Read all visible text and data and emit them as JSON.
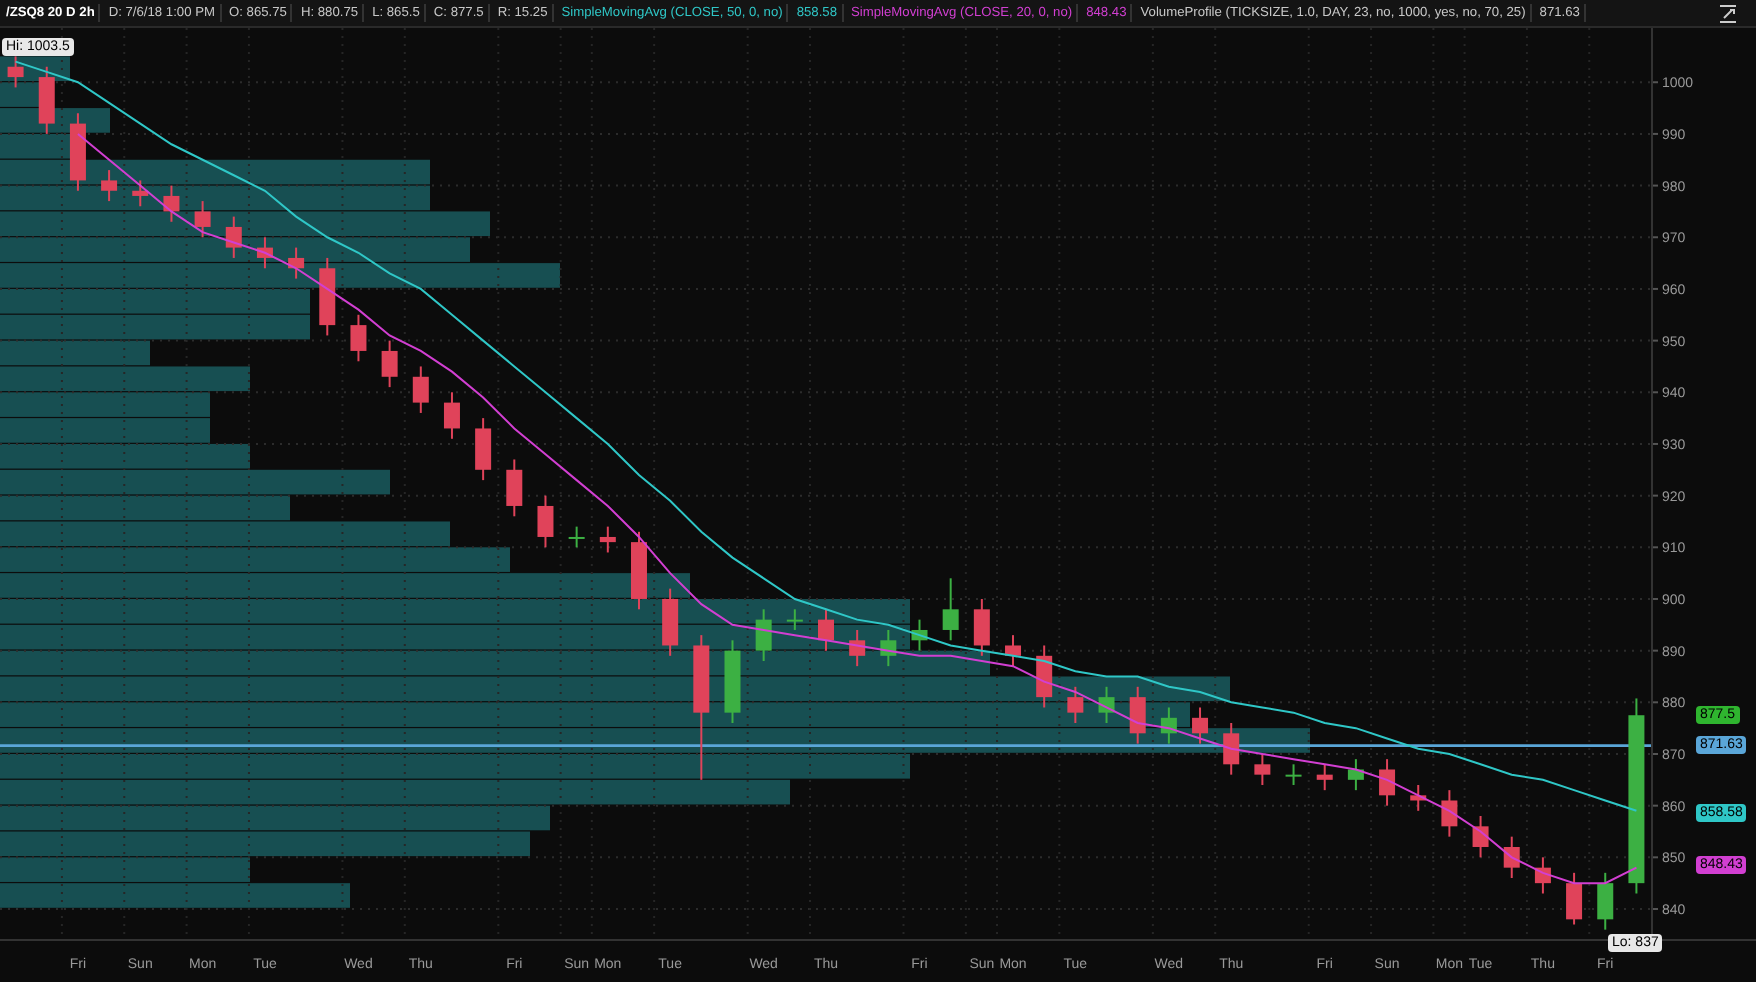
{
  "header": {
    "symbol": "/ZSQ8 20 D 2h",
    "fields": [
      "D: 7/6/18 1:00 PM",
      "O: 865.75",
      "H: 880.75",
      "L: 865.5",
      "C: 877.5",
      "R: 15.25"
    ],
    "series_values": [
      "858.58",
      "848.43"
    ],
    "volume_profile": {
      "label": "VolumeProfile (TICKSIZE, 1.0, DAY, 23, no, 1000, yes, no, 70, 25)",
      "value": "871.63"
    }
  },
  "chart": {
    "hi_label": "Hi: 1003.5",
    "lo_label": "Lo: 837",
    "price_tags": [
      {
        "value": "877.5",
        "color": "#2fb52f"
      },
      {
        "value": "871.63",
        "color": "#5aa6d8"
      },
      {
        "value": "858.58",
        "color": "#2fc7c7"
      },
      {
        "value": "848.43",
        "color": "#d23fd2"
      }
    ],
    "chart_data": {
      "type": "candlestick",
      "ylim": [
        834,
        1010.5
      ],
      "grid": true,
      "yticks": [
        840,
        850,
        860,
        870,
        880,
        890,
        900,
        910,
        920,
        930,
        940,
        950,
        960,
        970,
        980,
        990,
        1000
      ],
      "categories": [
        null,
        null,
        "Fri",
        null,
        "Sun",
        null,
        "Mon",
        null,
        "Tue",
        null,
        null,
        "Wed",
        null,
        "Thu",
        null,
        null,
        "Fri",
        null,
        "Sun",
        "Mon",
        null,
        "Tue",
        null,
        null,
        "Wed",
        null,
        "Thu",
        null,
        null,
        "Fri",
        null,
        "Sun",
        "Mon",
        null,
        "Tue",
        null,
        null,
        "Wed",
        null,
        "Thu",
        null,
        null,
        "Fri",
        null,
        "Sun",
        null,
        "Mon",
        "Tue",
        null,
        "Thu",
        null,
        "Fri",
        null
      ],
      "ohlc": [
        [
          1003,
          1005,
          999,
          1001
        ],
        [
          1001,
          1003,
          990,
          992
        ],
        [
          992,
          994,
          979,
          981
        ],
        [
          981,
          983,
          977,
          979
        ],
        [
          979,
          981,
          976,
          978
        ],
        [
          978,
          980,
          973,
          975
        ],
        [
          975,
          977,
          970,
          972
        ],
        [
          972,
          974,
          966,
          968
        ],
        [
          968,
          970,
          964,
          966
        ],
        [
          966,
          968,
          962,
          964
        ],
        [
          964,
          966,
          951,
          953
        ],
        [
          953,
          955,
          946,
          948
        ],
        [
          948,
          950,
          941,
          943
        ],
        [
          943,
          945,
          936,
          938
        ],
        [
          938,
          940,
          931,
          933
        ],
        [
          933,
          935,
          923,
          925
        ],
        [
          925,
          927,
          916,
          918
        ],
        [
          918,
          920,
          910,
          912
        ],
        [
          912,
          914,
          910,
          912
        ],
        [
          912,
          914,
          909,
          911
        ],
        [
          911,
          913,
          898,
          900
        ],
        [
          900,
          902,
          889,
          891
        ],
        [
          891,
          893,
          865,
          878
        ],
        [
          878,
          892,
          876,
          890
        ],
        [
          890,
          898,
          888,
          896
        ],
        [
          896,
          898,
          894,
          896
        ],
        [
          896,
          898,
          890,
          892
        ],
        [
          892,
          894,
          887,
          889
        ],
        [
          889,
          894,
          887,
          892
        ],
        [
          892,
          896,
          890,
          894
        ],
        [
          894,
          904,
          892,
          898
        ],
        [
          898,
          900,
          889,
          891
        ],
        [
          891,
          893,
          887,
          889
        ],
        [
          889,
          891,
          879,
          881
        ],
        [
          881,
          883,
          876,
          878
        ],
        [
          878,
          883,
          876,
          881
        ],
        [
          881,
          883,
          872,
          874
        ],
        [
          874,
          879,
          872,
          877
        ],
        [
          877,
          879,
          872,
          874
        ],
        [
          874,
          876,
          866,
          868
        ],
        [
          868,
          870,
          864,
          866
        ],
        [
          866,
          868,
          864,
          866
        ],
        [
          866,
          868,
          863,
          865
        ],
        [
          865,
          869,
          863,
          867
        ],
        [
          867,
          869,
          860,
          862
        ],
        [
          862,
          864,
          859,
          861
        ],
        [
          861,
          863,
          854,
          856
        ],
        [
          856,
          858,
          850,
          852
        ],
        [
          852,
          854,
          846,
          848
        ],
        [
          848,
          850,
          843,
          845
        ],
        [
          845,
          847,
          837,
          838
        ],
        [
          838,
          847,
          836,
          845
        ],
        [
          845,
          880.75,
          843,
          877.5
        ]
      ],
      "series": [
        {
          "name": "SimpleMovingAvg (CLOSE, 50, 0, no)",
          "type": "line",
          "color": "#2fc7c7",
          "values": [
            1004,
            1002,
            1000,
            996,
            992,
            988,
            985,
            982,
            979,
            974,
            970,
            967,
            963,
            960,
            955,
            950,
            945,
            940,
            935,
            930,
            924,
            919,
            913,
            908,
            904,
            900,
            898,
            896,
            895,
            893,
            891,
            890,
            889,
            888,
            886,
            885,
            885,
            883,
            882,
            880,
            879,
            878,
            876,
            875,
            873,
            871,
            870,
            868,
            866,
            865,
            863,
            861,
            859
          ]
        },
        {
          "name": "SimpleMovingAvg (CLOSE, 20, 0, no)",
          "type": "line",
          "color": "#d23fd2",
          "values": [
            null,
            null,
            990,
            985,
            980,
            975,
            971,
            969,
            967,
            964,
            960,
            956,
            951,
            948,
            944,
            939,
            933,
            928,
            923,
            918,
            912,
            905,
            899,
            895,
            894,
            893,
            892,
            891,
            890,
            889,
            889,
            888,
            887,
            884,
            882,
            879,
            876,
            875,
            873,
            871,
            870,
            869,
            868,
            867,
            865,
            862,
            859,
            855,
            850,
            847,
            845,
            845,
            848
          ]
        }
      ]
    }
  }
}
